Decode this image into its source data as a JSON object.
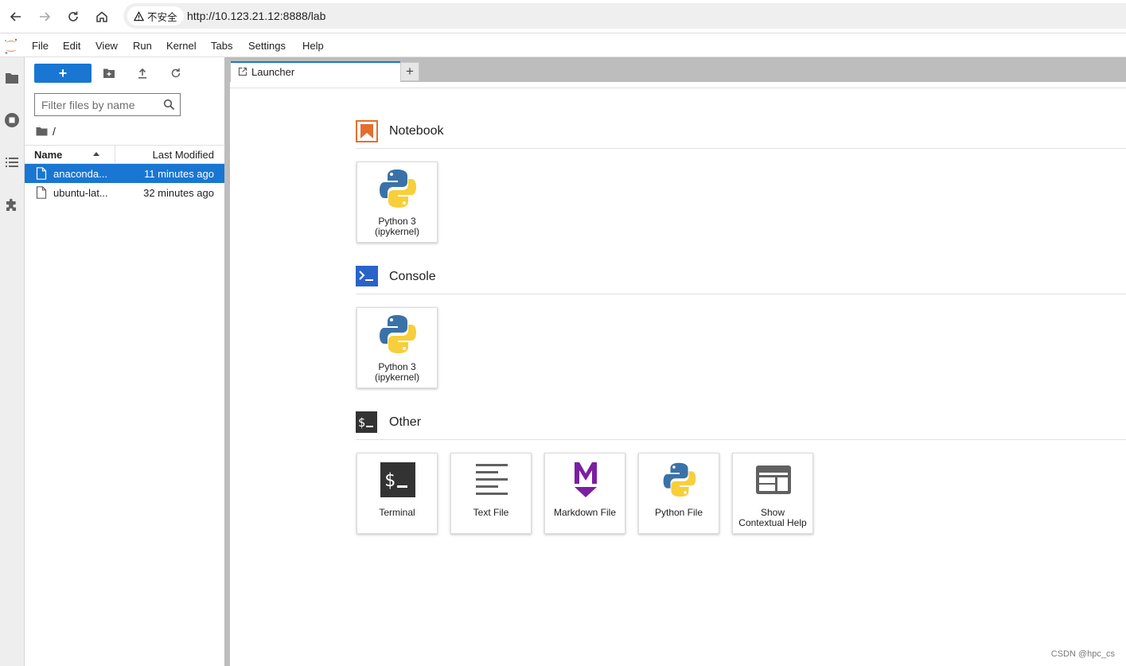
{
  "browser": {
    "back_icon": "arrow-left-icon",
    "forward_icon": "arrow-right-icon",
    "reload_icon": "reload-icon",
    "home_icon": "home-icon",
    "security_label": "不安全",
    "url": "http://10.123.21.12:8888/lab"
  },
  "menubar": {
    "items": [
      "File",
      "Edit",
      "View",
      "Run",
      "Kernel",
      "Tabs",
      "Settings",
      "Help"
    ]
  },
  "file_browser": {
    "new_label": "+",
    "filter_placeholder": "Filter files by name",
    "breadcrumb": "/",
    "columns": {
      "name": "Name",
      "modified": "Last Modified"
    },
    "files": [
      {
        "name": "anaconda...",
        "modified": "11 minutes ago",
        "selected": true
      },
      {
        "name": "ubuntu-lat...",
        "modified": "32 minutes ago",
        "selected": false
      }
    ]
  },
  "tabs": {
    "items": [
      {
        "label": "Launcher"
      }
    ],
    "add_label": "+"
  },
  "launcher": {
    "sections": [
      {
        "title": "Notebook",
        "cards": [
          {
            "label_line1": "Python 3",
            "label_line2": "(ipykernel)"
          }
        ]
      },
      {
        "title": "Console",
        "cards": [
          {
            "label_line1": "Python 3",
            "label_line2": "(ipykernel)"
          }
        ]
      },
      {
        "title": "Other",
        "cards": [
          {
            "label_line1": "Terminal",
            "label_line2": ""
          },
          {
            "label_line1": "Text File",
            "label_line2": ""
          },
          {
            "label_line1": "Markdown File",
            "label_line2": ""
          },
          {
            "label_line1": "Python File",
            "label_line2": ""
          },
          {
            "label_line1": "Show",
            "label_line2": "Contextual Help"
          }
        ]
      }
    ]
  },
  "colors": {
    "accent": "#1976d2",
    "notebook_orange": "#e46e2e",
    "console_blue": "#2963c9",
    "markdown_purple": "#7b1fa2"
  },
  "watermark": "CSDN @hpc_cs"
}
